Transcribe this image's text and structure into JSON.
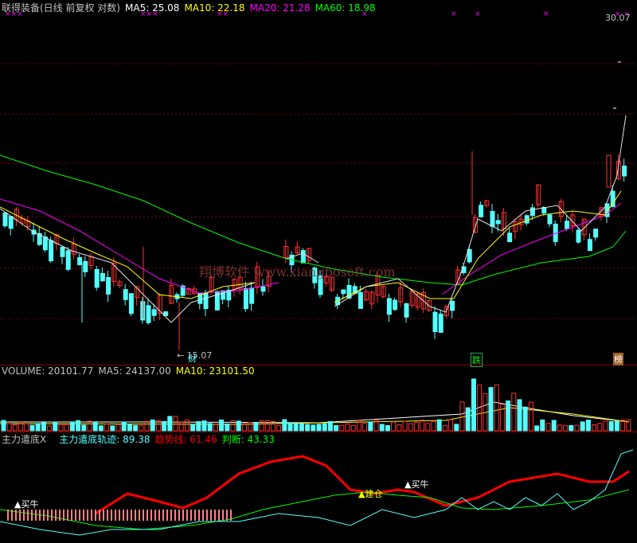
{
  "price_panel": {
    "title": "联得装备(日线 前复权 对数)",
    "ma5_label": "MA5:",
    "ma5_value": "25.08",
    "ma10_label": "MA10:",
    "ma10_value": "22.18",
    "ma20_label": "MA20:",
    "ma20_value": "21.28",
    "ma60_label": "MA60:",
    "ma60_value": "18.98",
    "high_label": "30.07",
    "low_label": "← 15.07",
    "watermark": "翔博软件 www.xiangbosoft.com",
    "markers": {
      "cai": "财",
      "die": "跌",
      "bang": "榜"
    },
    "colors": {
      "ma5": "#ffffff",
      "ma10": "#ffff00",
      "ma20": "#ff00ff",
      "ma60": "#00ff00",
      "up": "#ff3232",
      "down": "#54ffff"
    }
  },
  "volume_panel": {
    "label": "VOLUME:",
    "value": "20101.77",
    "ma5_label": "MA5:",
    "ma5_value": "24137.00",
    "ma10_label": "MA10:",
    "ma10_value": "23101.50"
  },
  "indicator_panel": {
    "name": "主力遣底X",
    "track_label": "主力遣底轨迹:",
    "track_value": "89.38",
    "trend_label": "趋势线:",
    "trend_value": "61.46",
    "judge_label": "判断:",
    "judge_value": "43.33",
    "signals": {
      "buy1": "▲买牛",
      "build": "▲建仓",
      "buy2": "▲买牛"
    },
    "colors": {
      "track": "#54ffff",
      "trend": "#ff0000",
      "judge": "#00ff00"
    }
  }
}
